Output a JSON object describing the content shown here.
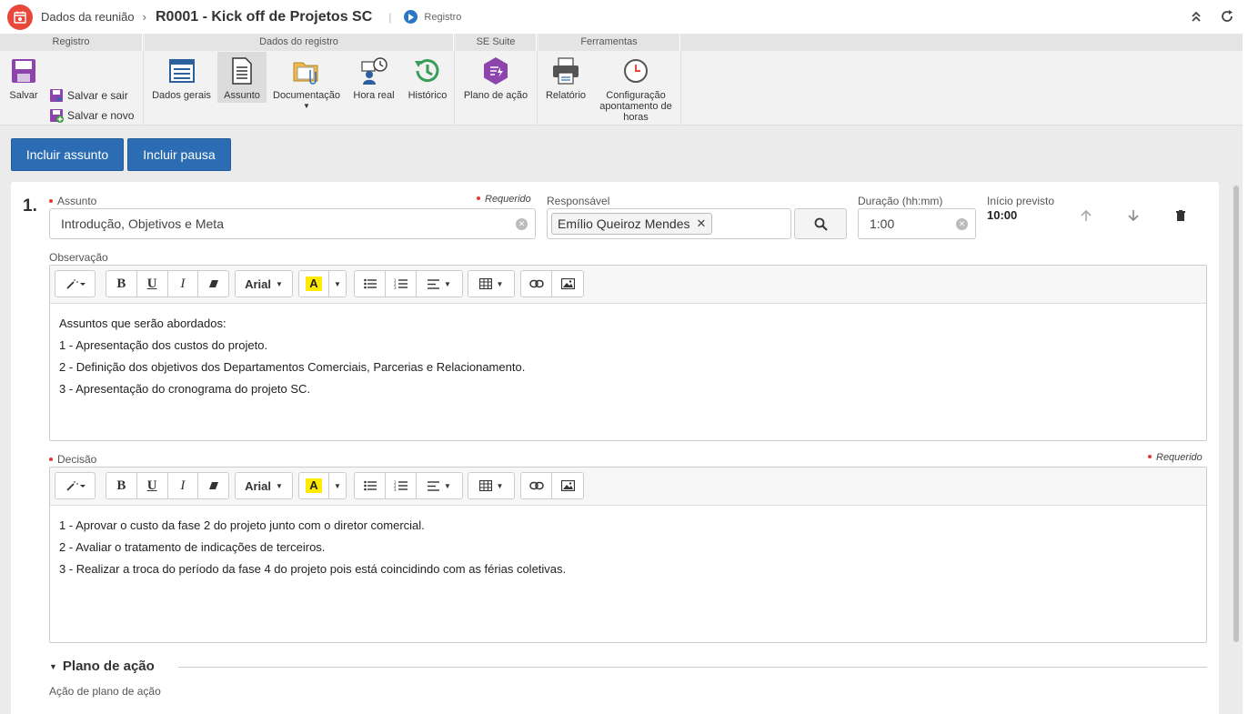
{
  "header": {
    "parent": "Dados da reunião",
    "title": "R0001 - Kick off de Projetos SC",
    "state": "Registro"
  },
  "ribbon": {
    "groups": {
      "registro": "Registro",
      "dados_registro": "Dados do registro",
      "se_suite": "SE Suite",
      "ferramentas": "Ferramentas"
    },
    "salvar": "Salvar",
    "salvar_sair": "Salvar e sair",
    "salvar_novo": "Salvar e novo",
    "dados_gerais": "Dados gerais",
    "assunto": "Assunto",
    "documentacao": "Documentação",
    "hora_real": "Hora real",
    "historico": "Histórico",
    "plano_acao": "Plano de ação",
    "relatorio": "Relatório",
    "configuracao": "Configuração apontamento de horas"
  },
  "actions": {
    "incluir_assunto": "Incluir assunto",
    "incluir_pausa": "Incluir pausa"
  },
  "item": {
    "number": "1.",
    "assunto_label": "Assunto",
    "required_label": "Requerido",
    "assunto_value": "Introdução, Objetivos e Meta",
    "responsavel_label": "Responsável",
    "responsavel_value": "Emílio Queiroz Mendes",
    "duracao_label": "Duração (hh:mm)",
    "duracao_value": "1:00",
    "inicio_label": "Início previsto",
    "inicio_value": "10:00",
    "observacao_label": "Observação",
    "observacao_lines": [
      "Assuntos que serão abordados:",
      "1 - Apresentação dos custos do projeto.",
      "2 - Definição dos objetivos dos Departamentos Comerciais, Parcerias e Relacionamento.",
      "3 - Apresentação do cronograma do projeto SC."
    ],
    "decisao_label": "Decisão",
    "decisao_lines": [
      "1 - Aprovar o custo da fase 2 do projeto junto com o diretor comercial.",
      "2 - Avaliar o tratamento de indicações de terceiros.",
      "3 - Realizar a troca do período da fase 4 do projeto pois está coincidindo com as férias coletivas."
    ],
    "plano_title": "Plano de ação",
    "plano_sub": "Ação de plano de ação"
  },
  "editor": {
    "font_name": "Arial",
    "highlight_letter": "A",
    "bold": "B",
    "underline": "U",
    "italic": "I"
  },
  "colors": {
    "primary": "#2b6cb3",
    "required": "#e53935",
    "logo": "#e8473a",
    "highlight": "#ffeb00"
  }
}
